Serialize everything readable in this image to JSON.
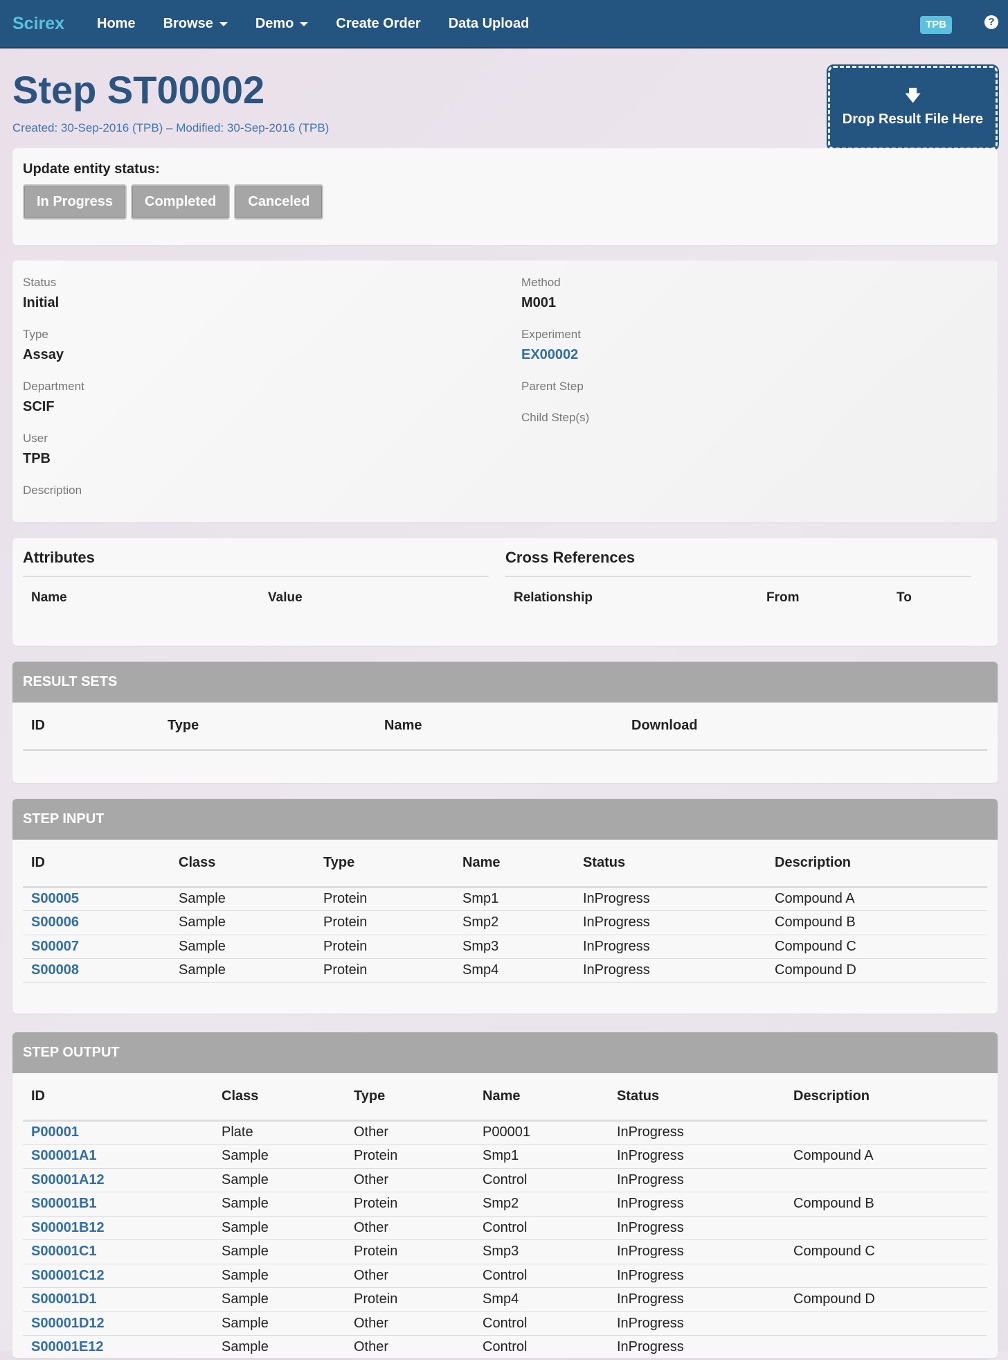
{
  "nav": {
    "brand": "Scirex",
    "items": [
      {
        "label": "Home",
        "dropdown": false
      },
      {
        "label": "Browse",
        "dropdown": true
      },
      {
        "label": "Demo",
        "dropdown": true
      },
      {
        "label": "Create Order",
        "dropdown": false
      },
      {
        "label": "Data Upload",
        "dropdown": false
      }
    ],
    "user": "TPB",
    "help": "?"
  },
  "header": {
    "title": "Step ST00002",
    "meta": "Created: 30-Sep-2016 (TPB) – Modified: 30-Sep-2016 (TPB)",
    "drop_arrow": "🡇",
    "drop_label": "Drop Result File Here"
  },
  "status_update": {
    "title": "Update entity status:",
    "buttons": [
      "In Progress",
      "Completed",
      "Canceled"
    ]
  },
  "details": {
    "status_label": "Status",
    "status_value": "Initial",
    "type_label": "Type",
    "type_value": "Assay",
    "department_label": "Department",
    "department_value": "SCIF",
    "user_label": "User",
    "user_value": "TPB",
    "description_label": "Description",
    "method_label": "Method",
    "method_value": "M001",
    "experiment_label": "Experiment",
    "experiment_value": "EX00002",
    "parent_label": "Parent Step",
    "child_label": "Child Step(s)"
  },
  "attributes": {
    "title": "Attributes",
    "col_name": "Name",
    "col_value": "Value"
  },
  "cross_refs": {
    "title": "Cross References",
    "col_relationship": "Relationship",
    "col_from": "From",
    "col_to": "To"
  },
  "result_sets": {
    "title": "RESULT SETS",
    "columns": [
      "ID",
      "Type",
      "Name",
      "Download"
    ]
  },
  "step_input": {
    "title": "STEP INPUT",
    "columns": [
      "ID",
      "Class",
      "Type",
      "Name",
      "Status",
      "Description"
    ],
    "rows": [
      [
        "S00005",
        "Sample",
        "Protein",
        "Smp1",
        "InProgress",
        "Compound A"
      ],
      [
        "S00006",
        "Sample",
        "Protein",
        "Smp2",
        "InProgress",
        "Compound B"
      ],
      [
        "S00007",
        "Sample",
        "Protein",
        "Smp3",
        "InProgress",
        "Compound C"
      ],
      [
        "S00008",
        "Sample",
        "Protein",
        "Smp4",
        "InProgress",
        "Compound D"
      ]
    ]
  },
  "step_output": {
    "title": "STEP OUTPUT",
    "columns": [
      "ID",
      "Class",
      "Type",
      "Name",
      "Status",
      "Description"
    ],
    "rows": [
      [
        "P00001",
        "Plate",
        "Other",
        "P00001",
        "InProgress",
        ""
      ],
      [
        "S00001A1",
        "Sample",
        "Protein",
        "Smp1",
        "InProgress",
        "Compound A"
      ],
      [
        "S00001A12",
        "Sample",
        "Other",
        "Control",
        "InProgress",
        ""
      ],
      [
        "S00001B1",
        "Sample",
        "Protein",
        "Smp2",
        "InProgress",
        "Compound B"
      ],
      [
        "S00001B12",
        "Sample",
        "Other",
        "Control",
        "InProgress",
        ""
      ],
      [
        "S00001C1",
        "Sample",
        "Protein",
        "Smp3",
        "InProgress",
        "Compound C"
      ],
      [
        "S00001C12",
        "Sample",
        "Other",
        "Control",
        "InProgress",
        ""
      ],
      [
        "S00001D1",
        "Sample",
        "Protein",
        "Smp4",
        "InProgress",
        "Compound D"
      ],
      [
        "S00001D12",
        "Sample",
        "Other",
        "Control",
        "InProgress",
        ""
      ],
      [
        "S00001E12",
        "Sample",
        "Other",
        "Control",
        "InProgress",
        ""
      ]
    ]
  }
}
